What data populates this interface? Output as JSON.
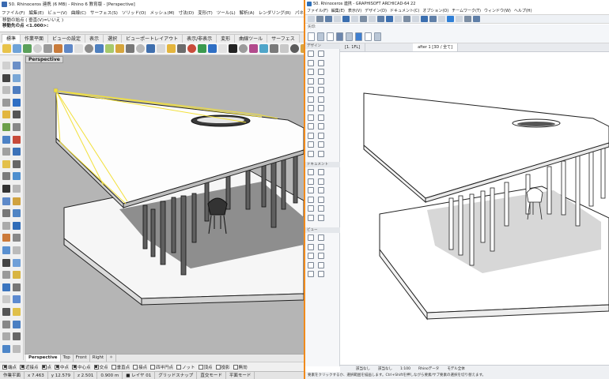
{
  "rhino": {
    "title": "50. Rhinoceros 連携 (6 MB) - Rhino 6 教育版 - [Perspective]",
    "menu": [
      "ファイル(F)",
      "編集(E)",
      "ビュー(V)",
      "曲線(C)",
      "サーフェス(S)",
      "ソリッド(O)",
      "メッシュ(M)",
      "寸法(D)",
      "変形(T)",
      "ツール(L)",
      "解析(A)",
      "レンダリング(R)",
      "パネル(P)",
      "ヘルプ"
    ],
    "command": {
      "line1": "移動の始点 ( 垂直(V)=いいえ )",
      "line2": "移動先の点 <1.000>:"
    },
    "tabs": [
      "標準",
      "作業平面",
      "ビューの設定",
      "表示",
      "選択",
      "ビューポートレイアウト",
      "表示/非表示",
      "変形",
      "曲線ツール",
      "サーフェス"
    ],
    "active_tab": "標準",
    "viewport_label": "Perspective",
    "viewport_tabs": [
      "Perspective",
      "Top",
      "Front",
      "Right",
      "✧"
    ],
    "osnaps": [
      {
        "label": "端点",
        "on": true
      },
      {
        "label": "近接点",
        "on": true
      },
      {
        "label": "点",
        "on": true
      },
      {
        "label": "中点",
        "on": true
      },
      {
        "label": "中心点",
        "on": true
      },
      {
        "label": "交点",
        "on": true
      },
      {
        "label": "垂直点",
        "on": false
      },
      {
        "label": "接点",
        "on": false
      },
      {
        "label": "四半円点",
        "on": false
      },
      {
        "label": "ノット",
        "on": false
      },
      {
        "label": "頂点",
        "on": false
      },
      {
        "label": "投影",
        "on": false
      },
      {
        "label": "無効",
        "on": false
      }
    ],
    "status": {
      "plane": "作業平面",
      "x": "x 7.463",
      "y": "y 12.579",
      "z": "z 2.501",
      "unit": "0.900 m",
      "layer": "■ レイヤ 01",
      "grid": "グリッドスナップ",
      "ortho": "直交モード",
      "planar": "平面モード"
    }
  },
  "archicad": {
    "title": "50. Rhinoceros 連携 - GRAPHISOFT ARCHICAD-64 22",
    "menu": [
      "ファイル(F)",
      "編集(E)",
      "表示(V)",
      "デザイン(D)",
      "ドキュメント(C)",
      "オプション(O)",
      "チームワーク(T)",
      "ウィンドウ(W)",
      "ヘルプ(H)"
    ],
    "info": "矢印:",
    "panel_headers": [
      "デザイン",
      "ドキュメント",
      "ビュー"
    ],
    "tabs": [
      "[1. 1FL]",
      "after 1 [3D / 全て]"
    ],
    "active_tab": "after 1 [3D / 全て]",
    "bottom": {
      "left": "該当なし",
      "mid": "該当なし",
      "scale": "1:100",
      "data": "Rhinoデータ",
      "model": "モデル全体"
    },
    "hint": "要素をクリックするか、選択範囲を描画します。Ctrl+Shiftを押しながら要素/サブ要素の選択を切り替えます。"
  }
}
